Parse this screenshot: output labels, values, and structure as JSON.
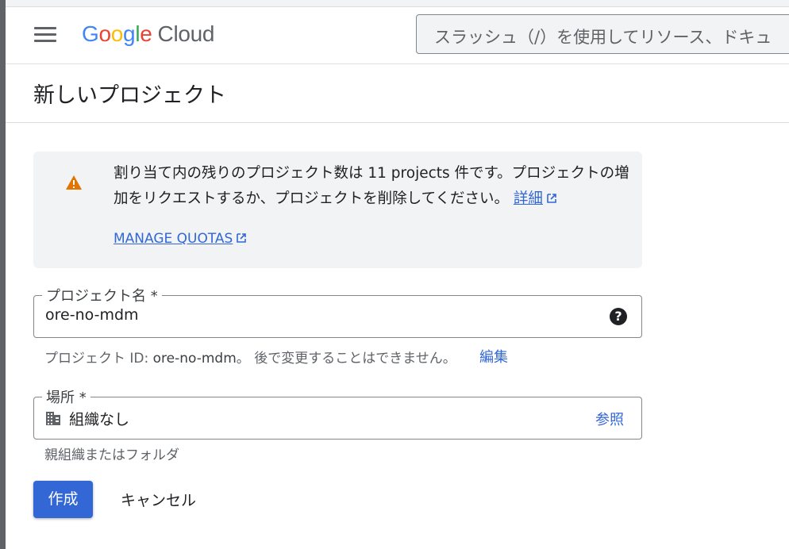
{
  "header": {
    "logo_parts": [
      "G",
      "o",
      "o",
      "g",
      "l",
      "e"
    ],
    "logo_cloud": "Cloud",
    "search_placeholder": "スラッシュ（/）を使用してリソース、ドキュ"
  },
  "page": {
    "title": "新しいプロジェクト"
  },
  "notice": {
    "text": "割り当て内の残りのプロジェクト数は 11 projects 件です。プロジェクトの増加をリクエストするか、プロジェクトを削除してください。",
    "details_link": "詳細",
    "quotas_link": "MANAGE QUOTAS"
  },
  "project_name": {
    "label": "プロジェクト名 *",
    "value": "ore-no-mdm",
    "help": "?"
  },
  "project_id": {
    "prefix": "プロジェクト ID: ",
    "id": "ore-no-mdm",
    "suffix": "。 後で変更することはできません。",
    "edit_label": "編集"
  },
  "location": {
    "label": "場所 *",
    "value": "組織なし",
    "browse_label": "参照",
    "hint": "親組織またはフォルダ"
  },
  "actions": {
    "create_label": "作成",
    "cancel_label": "キャンセル"
  },
  "colors": {
    "accent": "#3367d6",
    "warning": "#e37400",
    "notice_bg": "#f1f3f4"
  },
  "icons": {
    "menu": "hamburger-menu-icon",
    "warning": "warning-triangle-icon",
    "external": "open-in-new-icon",
    "help": "help-circle-icon",
    "location": "building-icon"
  }
}
